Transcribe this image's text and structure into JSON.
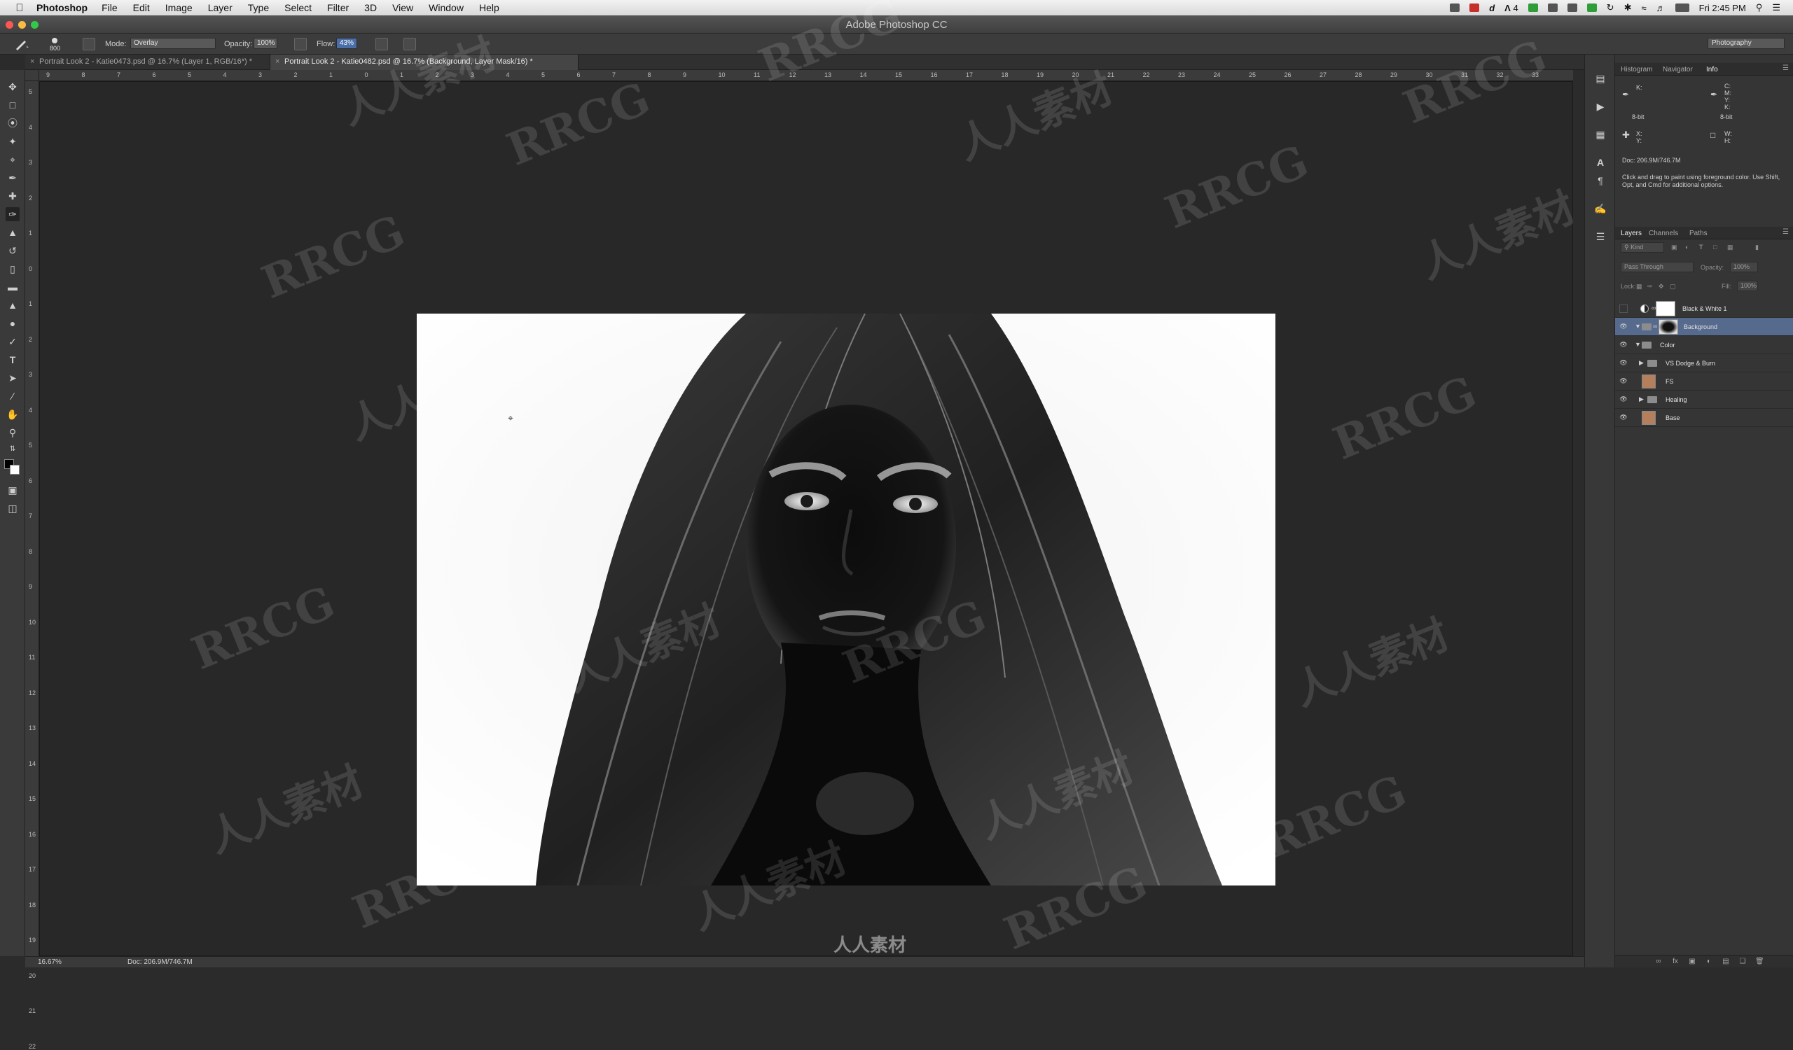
{
  "menubar": {
    "app_name": "Photoshop",
    "items": [
      "File",
      "Edit",
      "Image",
      "Layer",
      "Type",
      "Select",
      "Filter",
      "3D",
      "View",
      "Window",
      "Help"
    ],
    "clock": "Fri 2:45 PM",
    "badge_count": "4"
  },
  "window": {
    "title": "Adobe Photoshop CC"
  },
  "options_bar": {
    "brush_size": "800",
    "mode_label": "Mode:",
    "mode_value": "Overlay",
    "opacity_label": "Opacity:",
    "opacity_value": "100%",
    "flow_label": "Flow:",
    "flow_value": "43%",
    "workspace": "Photography"
  },
  "tabs": [
    {
      "label": "Portrait Look 2 - Katie0473.psd @ 16.7% (Layer 1, RGB/16*) *",
      "active": false
    },
    {
      "label": "Portrait Look 2 - Katie0482.psd @ 16.7% (Background, Layer Mask/16) *",
      "active": true
    }
  ],
  "ruler": {
    "top_labels": [
      "9",
      "8",
      "7",
      "6",
      "5",
      "4",
      "3",
      "2",
      "1",
      "0",
      "1",
      "2",
      "3",
      "4",
      "5",
      "6",
      "7",
      "8",
      "9",
      "10",
      "11",
      "12",
      "13",
      "14",
      "15",
      "16",
      "17",
      "18",
      "19",
      "20",
      "21",
      "22",
      "23",
      "24",
      "25",
      "26",
      "27",
      "28",
      "29",
      "30",
      "31",
      "32",
      "33"
    ],
    "left_labels": [
      "5",
      "4",
      "3",
      "2",
      "1",
      "0",
      "1",
      "2",
      "3",
      "4",
      "5",
      "6",
      "7",
      "8",
      "9",
      "10",
      "11",
      "12",
      "13",
      "14",
      "15",
      "16",
      "17",
      "18",
      "19",
      "20",
      "21",
      "22"
    ]
  },
  "status": {
    "zoom": "16.67%",
    "doc": "Doc: 206.9M/746.7M"
  },
  "info_panel": {
    "tabs": [
      "Histogram",
      "Navigator",
      "Info"
    ],
    "k_label": "K:",
    "bit_left": "8-bit",
    "cmyk_labels": "C:\nM:\nY:\nK:",
    "bit_right": "8-bit",
    "xy_label": "X:\nY:",
    "wh_label": "W:\nH:",
    "doc": "Doc: 206.9M/746.7M",
    "hint": "Click and drag to paint using foreground color. Use Shift, Opt, and Cmd for additional options."
  },
  "layers_panel": {
    "tabs": [
      "Layers",
      "Channels",
      "Paths"
    ],
    "filter_kind": "Kind",
    "blend_mode": "Pass Through",
    "opacity_label": "Opacity:",
    "opacity_value": "100%",
    "lock_label": "Lock:",
    "fill_label": "Fill:",
    "fill_value": "100%",
    "layers": [
      {
        "name": "Black & White 1",
        "type": "adjustment",
        "selected": false
      },
      {
        "name": "Background",
        "type": "masked",
        "selected": true
      },
      {
        "name": "Color",
        "type": "group-open",
        "selected": false
      },
      {
        "name": "VS Dodge & Burn",
        "type": "group",
        "selected": false
      },
      {
        "name": "FS",
        "type": "pixel",
        "selected": false
      },
      {
        "name": "Healing",
        "type": "group",
        "selected": false
      },
      {
        "name": "Base",
        "type": "pixel",
        "selected": false
      }
    ]
  },
  "watermark": {
    "latin": "RRCG",
    "cn": "人人素材",
    "bottom": "人人素材"
  }
}
